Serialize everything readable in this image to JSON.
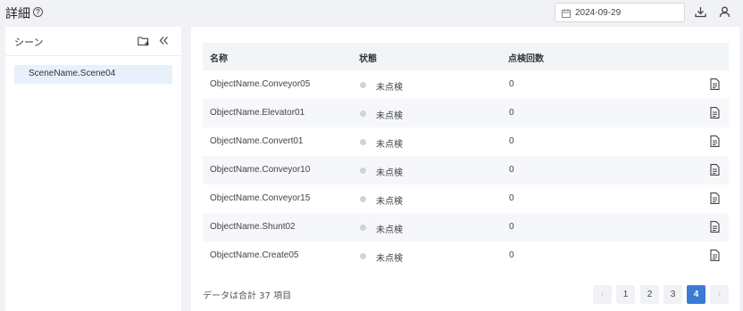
{
  "header": {
    "title": "詳細",
    "help_icon": "?",
    "date": "2024-09-29"
  },
  "sidebar": {
    "title": "シーン",
    "items": [
      {
        "label": "SceneName.Scene04"
      }
    ]
  },
  "table": {
    "columns": [
      "名称",
      "状態",
      "点検回数"
    ],
    "rows": [
      {
        "name": "ObjectName.Conveyor05",
        "status": "未点検",
        "count": "0"
      },
      {
        "name": "ObjectName.Elevator01",
        "status": "未点検",
        "count": "0"
      },
      {
        "name": "ObjectName.Convert01",
        "status": "未点検",
        "count": "0"
      },
      {
        "name": "ObjectName.Conveyor10",
        "status": "未点検",
        "count": "0"
      },
      {
        "name": "ObjectName.Conveyor15",
        "status": "未点検",
        "count": "0"
      },
      {
        "name": "ObjectName.Shunt02",
        "status": "未点検",
        "count": "0"
      },
      {
        "name": "ObjectName.Create05",
        "status": "未点検",
        "count": "0"
      }
    ]
  },
  "pagination": {
    "total_text": "データは合計 37 項目",
    "prev": "‹",
    "next": "›",
    "pages": [
      "1",
      "2",
      "3",
      "4"
    ],
    "current": "4"
  },
  "colors": {
    "accent": "#3a7bd5",
    "selected_bg": "#e8f0fc",
    "status_dot": "#d0d3d8"
  }
}
